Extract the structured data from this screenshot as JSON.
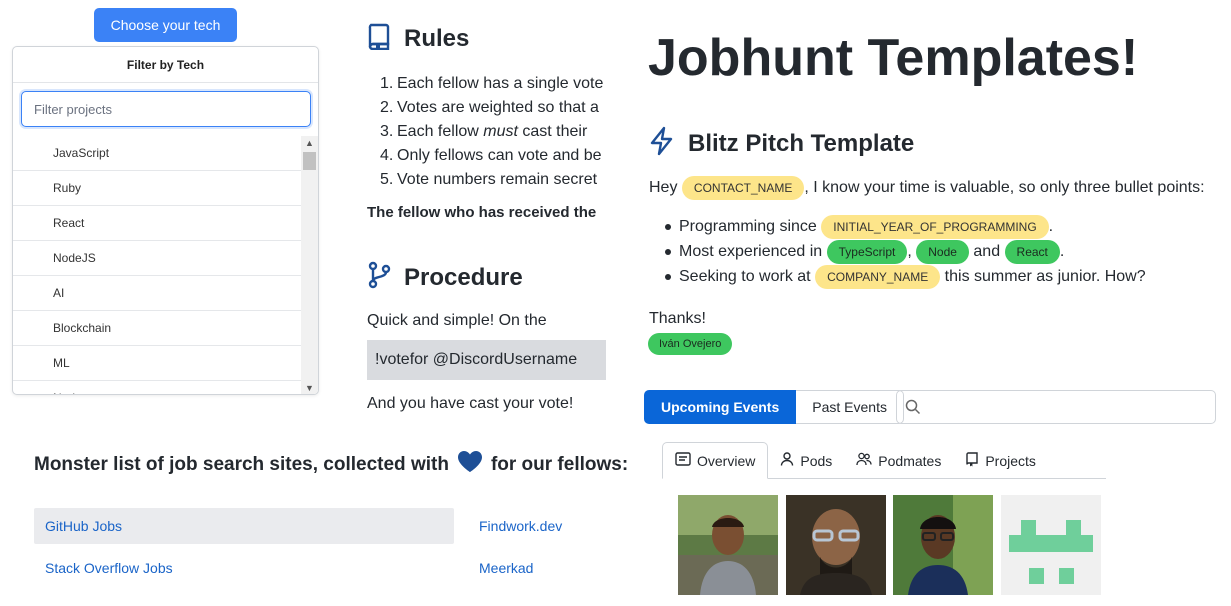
{
  "filter": {
    "choose_button": "Choose your tech",
    "title": "Filter by Tech",
    "search_placeholder": "Filter projects",
    "items": [
      "JavaScript",
      "Ruby",
      "React",
      "NodeJS",
      "AI",
      "Blockchain",
      "ML",
      "Node"
    ]
  },
  "rules": {
    "title": "Rules",
    "items": [
      {
        "num": "1.",
        "text": "Each fellow has a single vote"
      },
      {
        "num": "2.",
        "text": "Votes are weighted so that a"
      },
      {
        "num": "3.",
        "text_before": "Each fellow ",
        "emphasis": "must",
        "text_after": " cast their"
      },
      {
        "num": "4.",
        "text": "Only fellows can vote and be"
      },
      {
        "num": "5.",
        "text": "Vote numbers remain secret"
      }
    ],
    "fellow_line": "The fellow who has received the"
  },
  "procedure": {
    "title": "Procedure",
    "intro": "Quick and simple! On the",
    "command": "!votefor @DiscordUsername",
    "outro": "And you have cast your vote!"
  },
  "jobhunt": {
    "title": "Jobhunt Templates!",
    "blitz_title": "Blitz Pitch Template",
    "greeting": "Hey",
    "contact_tag": "CONTACT_NAME",
    "greeting_rest": ", I know your time is valuable, so only three bullet points:",
    "b1_text": "Programming since",
    "b1_tag": "INITIAL_YEAR_OF_PROGRAMMING",
    "b1_end": ".",
    "b2_text": "Most experienced in",
    "b2_tag1": "TypeScript",
    "b2_sep": ",",
    "b2_tag2": "Node",
    "b2_and": "and",
    "b2_tag3": "React",
    "b2_end": ".",
    "b3_text": "Seeking to work at",
    "b3_tag": "COMPANY_NAME",
    "b3_rest": "this summer as junior. How?",
    "thanks": "Thanks!",
    "author": "Iván Ovejero"
  },
  "events": {
    "upcoming": "Upcoming Events",
    "past": "Past Events",
    "tabs": [
      "Overview",
      "Pods",
      "Podmates",
      "Projects"
    ]
  },
  "jobsites": {
    "heading_before": "Monster list of job search sites, collected with",
    "heading_after": "for our fellows:",
    "sites": [
      "GitHub Jobs",
      "Findwork.dev",
      "Stack Overflow Jobs",
      "Meerkad"
    ]
  },
  "colors": {
    "primary": "#0a66d8",
    "button_blue": "#3b82f6",
    "tag_yellow": "#fde58a",
    "tag_green": "#3ec75f",
    "heart": "#1e4f96",
    "link": "#1a64c8"
  }
}
